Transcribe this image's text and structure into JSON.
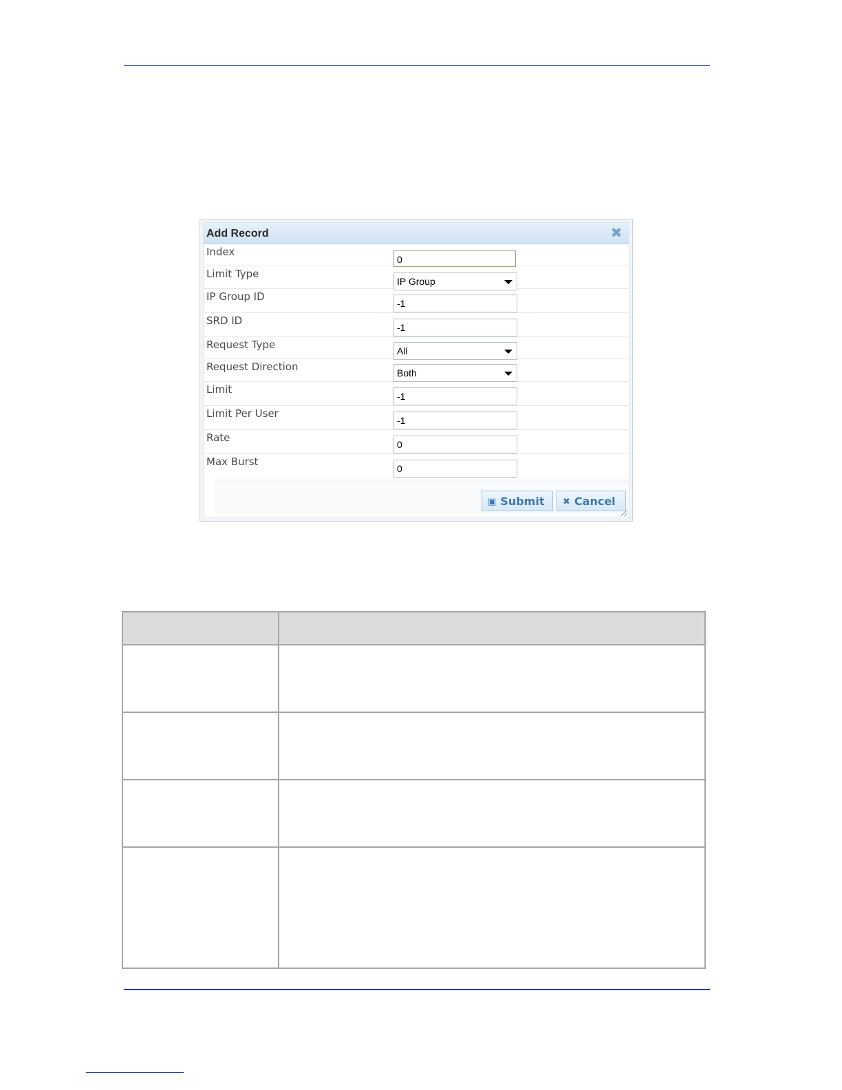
{
  "dialog": {
    "title": "Add Record",
    "fields": [
      {
        "label": "Index",
        "value": "0",
        "kind": "input"
      },
      {
        "label": "Limit Type",
        "value": "IP Group",
        "kind": "select"
      },
      {
        "label": "IP Group ID",
        "value": "-1",
        "kind": "input"
      },
      {
        "label": "SRD ID",
        "value": "-1",
        "kind": "input"
      },
      {
        "label": "Request Type",
        "value": "All",
        "kind": "select"
      },
      {
        "label": "Request Direction",
        "value": "Both",
        "kind": "select"
      },
      {
        "label": "Limit",
        "value": "-1",
        "kind": "input"
      },
      {
        "label": "Limit Per User",
        "value": "-1",
        "kind": "input"
      },
      {
        "label": "Rate",
        "value": "0",
        "kind": "input"
      },
      {
        "label": "Max Burst",
        "value": "0",
        "kind": "input"
      }
    ],
    "submit_label": "Submit",
    "cancel_label": "Cancel",
    "accent_color": "#3e78ad",
    "icons": {
      "close": "close-icon",
      "submit": "save-icon",
      "cancel": "x-icon"
    }
  }
}
